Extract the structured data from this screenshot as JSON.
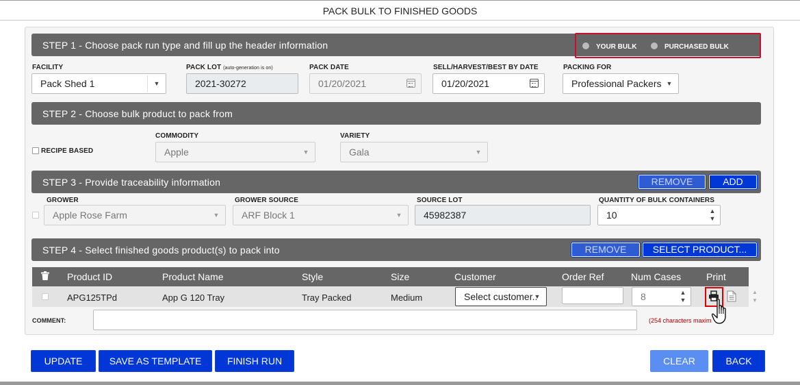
{
  "window": {
    "title": "PACK BULK TO FINISHED GOODS"
  },
  "step1": {
    "title": "STEP 1 - Choose pack run type and fill up the header information",
    "radio_your": "YOUR BULK",
    "radio_purchased": "PURCHASED BULK",
    "facility": {
      "label": "FACILITY",
      "value": "Pack Shed 1"
    },
    "pack_lot": {
      "label": "PACK LOT",
      "note": "(auto-generation is on)",
      "value": "2021-30272"
    },
    "pack_date": {
      "label": "PACK DATE",
      "value": "01/20/2021"
    },
    "sell_date": {
      "label": "SELL/HARVEST/BEST BY DATE",
      "value": "01/20/2021"
    },
    "packing_for": {
      "label": "PACKING FOR",
      "value": "Professional Packers"
    }
  },
  "step2": {
    "title": "STEP 2 - Choose bulk product to pack from",
    "recipe_label": "RECIPE BASED",
    "commodity": {
      "label": "COMMODITY",
      "value": "Apple"
    },
    "variety": {
      "label": "VARIETY",
      "value": "Gala"
    }
  },
  "step3": {
    "title": "STEP 3 - Provide traceability information",
    "remove": "REMOVE",
    "add": "ADD",
    "grower": {
      "label": "GROWER",
      "value": "Apple Rose Farm"
    },
    "grower_source": {
      "label": "GROWER SOURCE",
      "value": "ARF Block 1"
    },
    "source_lot": {
      "label": "SOURCE LOT",
      "value": "45982387"
    },
    "qty": {
      "label": "QUANTITY OF BULK CONTAINERS",
      "value": "10"
    }
  },
  "step4": {
    "title": "STEP 4 - Select finished goods product(s) to pack into",
    "remove": "REMOVE",
    "select_product": "SELECT PRODUCT...",
    "columns": [
      "Product ID",
      "Product Name",
      "Style",
      "Size",
      "Customer",
      "Order Ref",
      "Num Cases",
      "Print"
    ],
    "row": {
      "product_id": "APG125TPd",
      "product_name": "App G 120 Tray",
      "style": "Tray Packed",
      "size": "Medium",
      "customer": "Select customer..",
      "order_ref": "",
      "num_cases": "8"
    },
    "comment_label": "COMMENT:",
    "comment_note": "(254 characters maxim"
  },
  "footer": {
    "update": "UPDATE",
    "save_template": "SAVE AS TEMPLATE",
    "finish_run": "FINISH RUN",
    "clear": "CLEAR",
    "back": "BACK"
  },
  "colors": {
    "accent": "#0037d6",
    "bar": "#666666",
    "highlight": "#dd0000"
  }
}
